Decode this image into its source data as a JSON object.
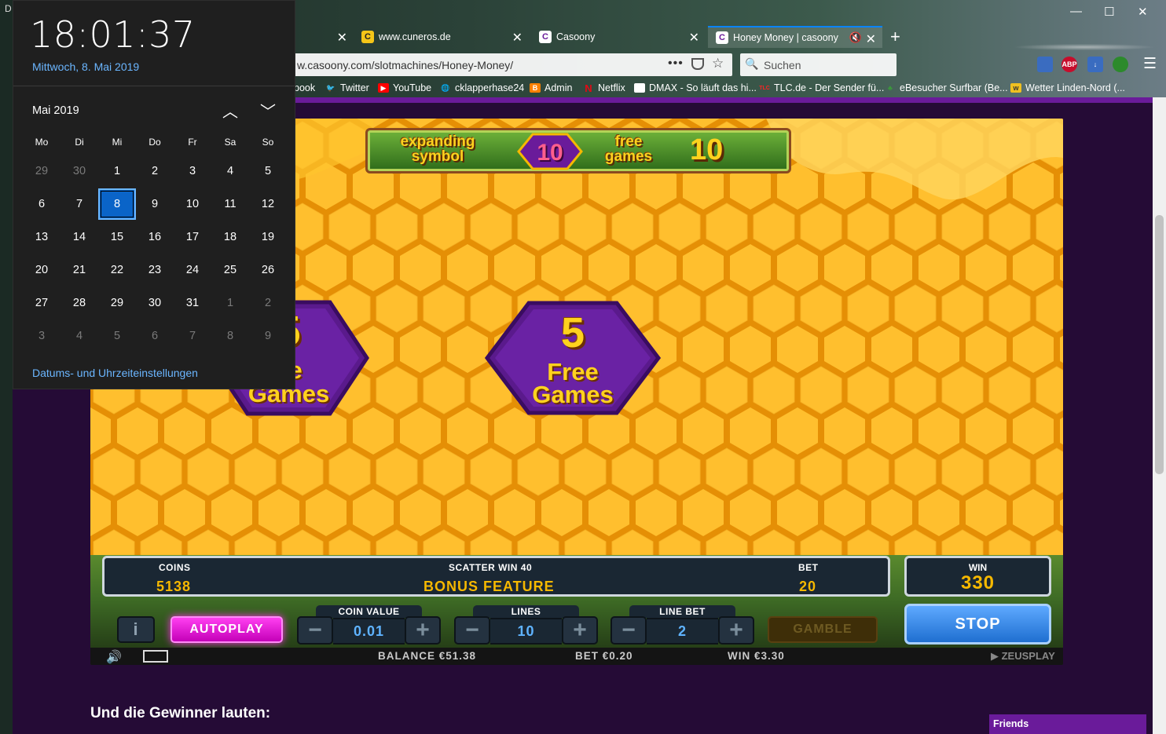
{
  "browser": {
    "tabs": [
      {
        "label": "",
        "favicon": ""
      },
      {
        "label": "www.cuneros.de",
        "favicon": "C"
      },
      {
        "label": "Casoony",
        "favicon": "C"
      },
      {
        "label": "Honey Money | casoony",
        "favicon": "C"
      }
    ],
    "url": "w.casoony.com/slotmachines/Honey-Money/",
    "url_more": "•••",
    "search_placeholder": "Suchen",
    "new_tab_glyph": "+",
    "bookmarks": [
      {
        "label": "book",
        "icon": "facebook-icon",
        "color": "#3b5998"
      },
      {
        "label": "Twitter",
        "icon": "twitter-icon",
        "color": "#1da1f2"
      },
      {
        "label": "YouTube",
        "icon": "youtube-icon",
        "color": "#ff0000"
      },
      {
        "label": "cklapperhase24",
        "icon": "globe-icon",
        "color": "#dddddd"
      },
      {
        "label": "Admin",
        "icon": "blogger-icon",
        "color": "#ff8000"
      },
      {
        "label": "Netflix",
        "icon": "netflix-icon",
        "color": "#e50914"
      },
      {
        "label": "DMAX - So läuft das hi...",
        "icon": "dmax-icon",
        "color": "#ffffff"
      },
      {
        "label": "TLC.de - Der Sender fü...",
        "icon": "tlc-icon",
        "color": "#ff2222"
      },
      {
        "label": "eBesucher Surfbar (Be...",
        "icon": "ebesucher-icon",
        "color": "#3a9a3a"
      },
      {
        "label": "Wetter Linden-Nord (...",
        "icon": "weather-icon",
        "color": "#f0c020"
      }
    ],
    "toolbar_icons": [
      {
        "label": "",
        "color": "#3a6cc0",
        "name": "reader-view-icon"
      },
      {
        "label": "ABP",
        "color": "#c70d2c",
        "name": "adblock-icon"
      },
      {
        "label": "↓",
        "color": "#3a6cc0",
        "name": "download-icon"
      },
      {
        "label": "",
        "color": "#2c8a2c",
        "name": "extension-icon"
      }
    ],
    "left_edge_text": "D"
  },
  "clock": {
    "time": "18:01:37",
    "date": "Mittwoch, 8. Mai 2019",
    "month": "Mai 2019",
    "weekdays": [
      "Mo",
      "Di",
      "Mi",
      "Do",
      "Fr",
      "Sa",
      "So"
    ],
    "weeks": [
      [
        {
          "d": "29",
          "dim": true
        },
        {
          "d": "30",
          "dim": true
        },
        {
          "d": "1"
        },
        {
          "d": "2"
        },
        {
          "d": "3"
        },
        {
          "d": "4"
        },
        {
          "d": "5"
        }
      ],
      [
        {
          "d": "6"
        },
        {
          "d": "7"
        },
        {
          "d": "8",
          "today": true
        },
        {
          "d": "9"
        },
        {
          "d": "10"
        },
        {
          "d": "11"
        },
        {
          "d": "12"
        }
      ],
      [
        {
          "d": "13"
        },
        {
          "d": "14"
        },
        {
          "d": "15"
        },
        {
          "d": "16"
        },
        {
          "d": "17"
        },
        {
          "d": "18"
        },
        {
          "d": "19"
        }
      ],
      [
        {
          "d": "20"
        },
        {
          "d": "21"
        },
        {
          "d": "22"
        },
        {
          "d": "23"
        },
        {
          "d": "24"
        },
        {
          "d": "25"
        },
        {
          "d": "26"
        }
      ],
      [
        {
          "d": "27"
        },
        {
          "d": "28"
        },
        {
          "d": "29"
        },
        {
          "d": "30"
        },
        {
          "d": "31"
        },
        {
          "d": "1",
          "dim": true
        },
        {
          "d": "2",
          "dim": true
        }
      ],
      [
        {
          "d": "3",
          "dim": true
        },
        {
          "d": "4",
          "dim": true
        },
        {
          "d": "5",
          "dim": true
        },
        {
          "d": "6",
          "dim": true
        },
        {
          "d": "7",
          "dim": true
        },
        {
          "d": "8",
          "dim": true
        },
        {
          "d": "9",
          "dim": true
        }
      ]
    ],
    "settings_link": "Datums- und Uhrzeiteinstellungen"
  },
  "game": {
    "banner": {
      "expanding": "expanding",
      "symbol": "symbol",
      "left_number": "10",
      "free": "free",
      "games": "games",
      "right_number": "10"
    },
    "hex_left": {
      "number": "5",
      "line1": "ee",
      "line2": "Games"
    },
    "hex_center": {
      "number": "5",
      "line1": "Free",
      "line2": "Games"
    },
    "info": {
      "coins_label": "COINS",
      "coins_value": "5138",
      "scatter_label": "SCATTER WIN 40",
      "feature_value": "BONUS FEATURE",
      "bet_label": "BET",
      "bet_value": "20"
    },
    "win": {
      "label": "WIN",
      "value": "330"
    },
    "buttons": {
      "info": "i",
      "autoplay": "AUTOPLAY",
      "gamble": "GAMBLE",
      "stop": "STOP"
    },
    "steppers": [
      {
        "label": "COIN VALUE",
        "value": "0.01",
        "name": "coin-value"
      },
      {
        "label": "LINES",
        "value": "10",
        "name": "lines"
      },
      {
        "label": "LINE BET",
        "value": "2",
        "name": "line-bet"
      }
    ],
    "status": {
      "balance": "BALANCE €51.38",
      "bet": "BET €0.20",
      "win": "WIN €3.30",
      "logo": "ZEUSPLAY"
    }
  },
  "page": {
    "winners_heading": "Und die Gewinner lauten:",
    "friends": "Friends"
  },
  "colors": {
    "accent_blue": "#0a64c8",
    "honey": "#f1a40b",
    "site_purple": "#6a1b9a",
    "autoplay_pink": "#ff3ff0"
  }
}
